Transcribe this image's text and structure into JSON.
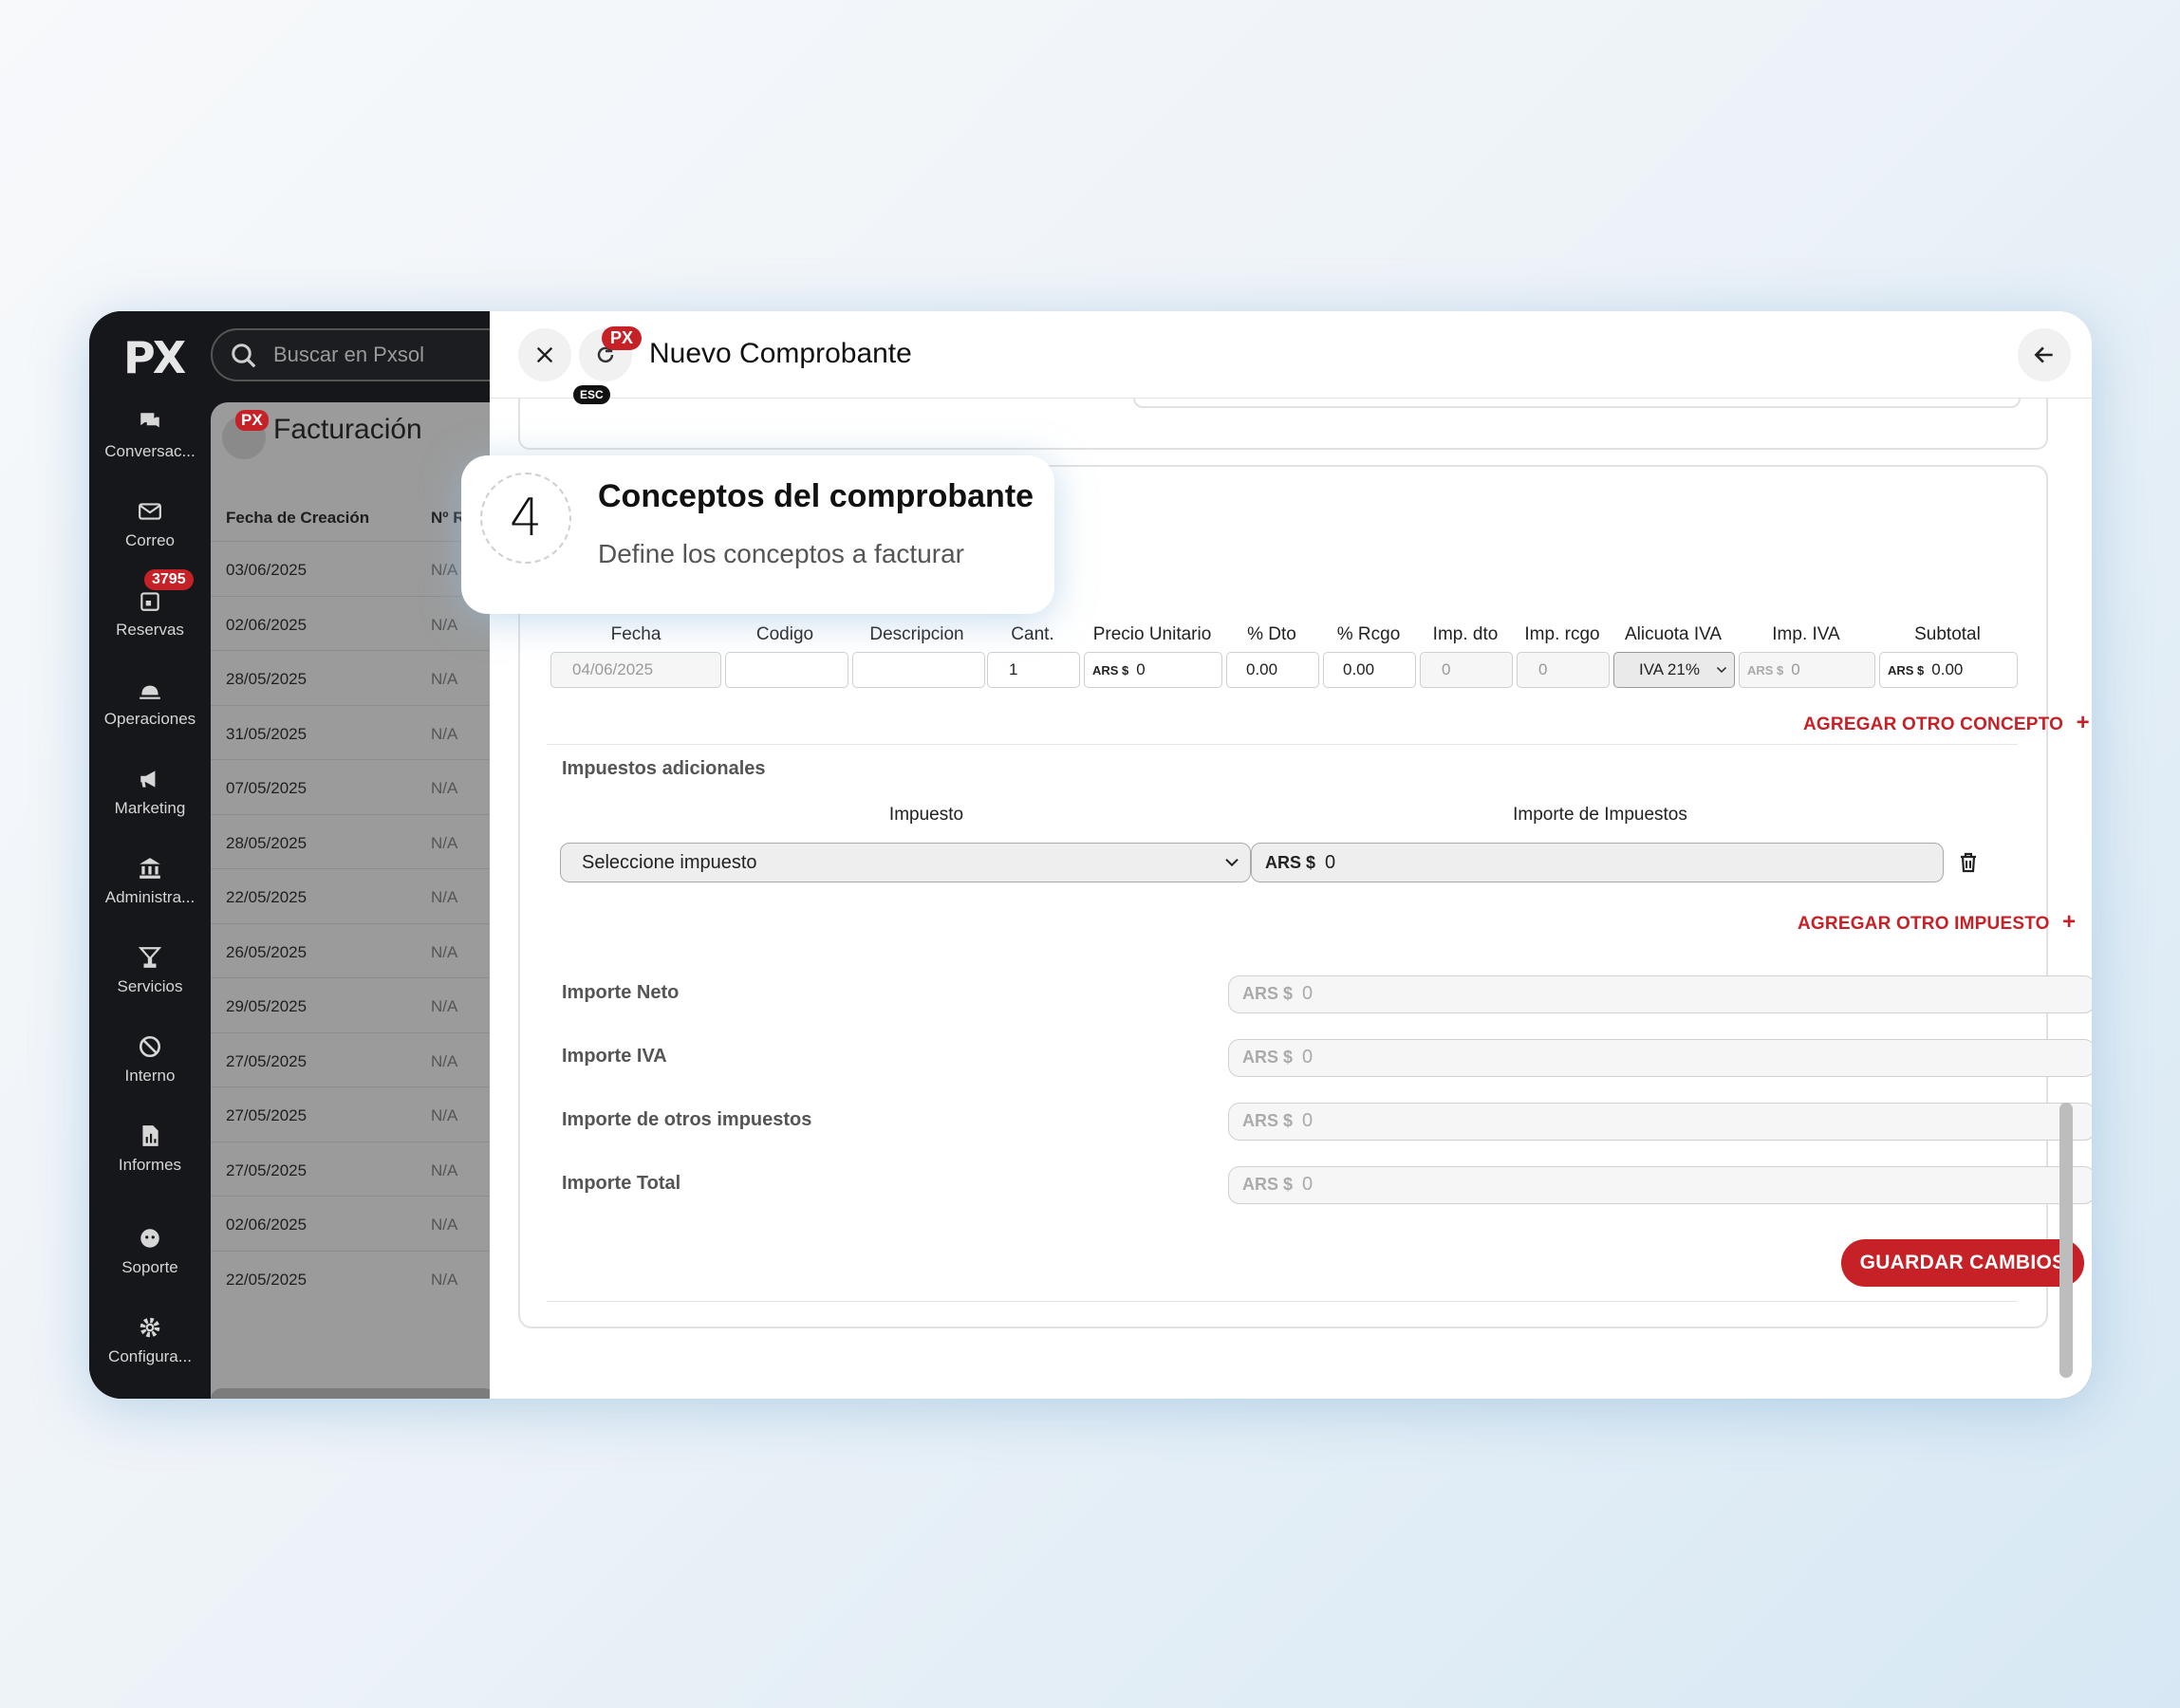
{
  "sidebar": {
    "logo": "PX",
    "items": [
      {
        "label": "Conversac...",
        "icon": "chat-icon"
      },
      {
        "label": "Correo",
        "icon": "mail-icon"
      },
      {
        "label": "Reservas",
        "icon": "calendar-icon",
        "badge": "3795"
      },
      {
        "label": "Operaciones",
        "icon": "bell-icon"
      },
      {
        "label": "Marketing",
        "icon": "megaphone-icon"
      },
      {
        "label": "Administra...",
        "icon": "bank-icon"
      },
      {
        "label": "Servicios",
        "icon": "cocktail-icon"
      },
      {
        "label": "Interno",
        "icon": "ban-icon"
      },
      {
        "label": "Informes",
        "icon": "report-icon"
      },
      {
        "label": "Soporte",
        "icon": "support-icon"
      },
      {
        "label": "Configura...",
        "icon": "gear-icon"
      }
    ]
  },
  "search": {
    "placeholder": "Buscar en Pxsol"
  },
  "list": {
    "title": "Facturación",
    "px_badge": "PX",
    "col_date": "Fecha de Creación",
    "col_num": "Nº R",
    "rows": [
      {
        "date": "03/06/2025",
        "num": "N/A"
      },
      {
        "date": "02/06/2025",
        "num": "N/A"
      },
      {
        "date": "28/05/2025",
        "num": "N/A"
      },
      {
        "date": "31/05/2025",
        "num": "N/A"
      },
      {
        "date": "07/05/2025",
        "num": "N/A"
      },
      {
        "date": "28/05/2025",
        "num": "N/A"
      },
      {
        "date": "22/05/2025",
        "num": "N/A"
      },
      {
        "date": "26/05/2025",
        "num": "N/A"
      },
      {
        "date": "29/05/2025",
        "num": "N/A"
      },
      {
        "date": "27/05/2025",
        "num": "N/A"
      },
      {
        "date": "27/05/2025",
        "num": "N/A"
      },
      {
        "date": "27/05/2025",
        "num": "N/A"
      },
      {
        "date": "02/06/2025",
        "num": "N/A"
      },
      {
        "date": "22/05/2025",
        "num": "N/A"
      }
    ]
  },
  "modal": {
    "title": "Nuevo Comprobante",
    "esc": "ESC",
    "px_badge": "PX"
  },
  "callout": {
    "step": "4",
    "title": "Conceptos del comprobante",
    "subtitle": "Define los conceptos a facturar"
  },
  "concepts": {
    "headers": [
      "Fecha",
      "Codigo",
      "Descripcion",
      "Cant.",
      "Precio Unitario",
      "% Dto",
      "% Rcgo",
      "Imp. dto",
      "Imp. rcgo",
      "Alicuota IVA",
      "Imp. IVA",
      "Subtotal"
    ],
    "row": {
      "fecha": "04/06/2025",
      "codigo": "",
      "descripcion": "",
      "cant": "1",
      "precio_prefix": "ARS $",
      "precio": "0",
      "dto": "0.00",
      "rcgo": "0.00",
      "imp_dto": "0",
      "imp_rcgo": "0",
      "alicuota": "IVA 21%",
      "imp_iva_prefix": "ARS $",
      "imp_iva": "0",
      "subtotal_prefix": "ARS $",
      "subtotal": "0.00"
    },
    "add_concept": "AGREGAR OTRO CONCEPTO"
  },
  "taxes": {
    "section_title": "Impuestos adicionales",
    "col_tax": "Impuesto",
    "col_amount": "Importe de Impuestos",
    "select_value": "Seleccione impuesto",
    "amount_prefix": "ARS $",
    "amount_value": "0",
    "add_tax": "AGREGAR OTRO IMPUESTO"
  },
  "totals": [
    {
      "label": "Importe Neto",
      "prefix": "ARS $",
      "value": "0"
    },
    {
      "label": "Importe IVA",
      "prefix": "ARS $",
      "value": "0"
    },
    {
      "label": "Importe de otros impuestos",
      "prefix": "ARS $",
      "value": "0"
    },
    {
      "label": "Importe Total",
      "prefix": "ARS $",
      "value": "0"
    }
  ],
  "save_label": "GUARDAR CAMBIOS",
  "colors": {
    "accent": "#c62127",
    "sidebar_bg": "#16171a"
  }
}
